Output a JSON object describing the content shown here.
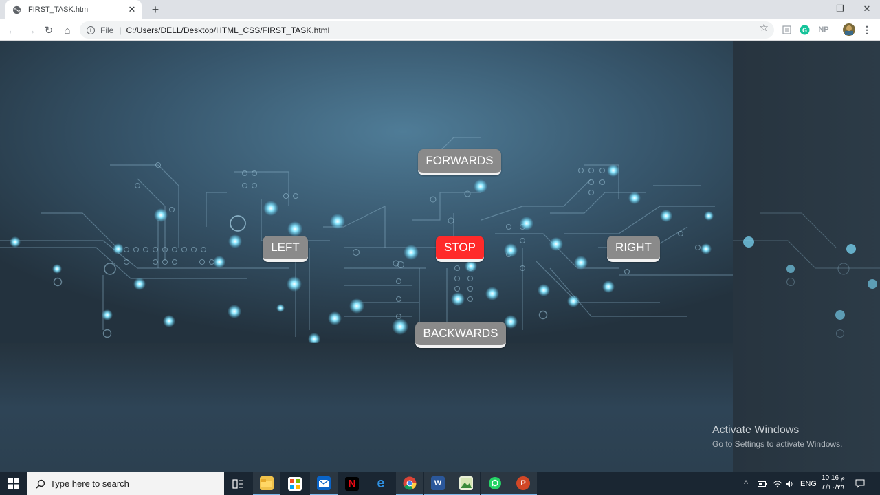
{
  "browser": {
    "tab_title": "FIRST_TASK.html",
    "new_tab": "+",
    "scheme_label": "File",
    "separator": "|",
    "url": "C:/Users/DELL/Desktop/HTML_CSS/FIRST_TASK.html",
    "ext_np": "NP",
    "window": {
      "minimize": "—",
      "maximize": "❐",
      "close": "✕"
    }
  },
  "controls": {
    "forwards": "FORWARDS",
    "left": "LEFT",
    "stop": "STOP",
    "right": "RIGHT",
    "backwards": "BACKWARDS"
  },
  "colors": {
    "button_bg": "#8a8a8a",
    "stop_bg": "#ff2a2a",
    "glow": "#5fd8ff"
  },
  "watermark": {
    "title": "Activate Windows",
    "subtitle": "Go to Settings to activate Windows."
  },
  "taskbar": {
    "search_placeholder": "Type here to search",
    "apps": [
      "task-view",
      "file-explorer",
      "store",
      "mail",
      "netflix",
      "edge",
      "chrome",
      "word",
      "photos",
      "whatsapp",
      "powerpoint"
    ],
    "language": "ENG",
    "time": "10:16 م",
    "date": "٤/١٠/٢٩"
  }
}
